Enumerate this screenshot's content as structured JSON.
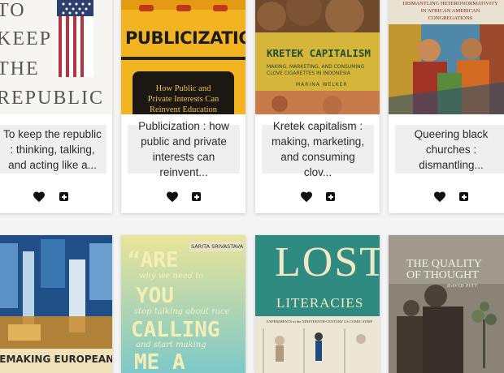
{
  "books_row1": [
    {
      "title": "To keep the republic : thinking, talking, and acting like a...",
      "cover_text": [
        "TO",
        "KEEP",
        "THE",
        "REPUBLIC"
      ]
    },
    {
      "title": "Publicization : how public and private interests can reinvent...",
      "cover_title": "PUBLICIZATION",
      "cover_subtitle": [
        "How Public and",
        "Private Interests Can",
        "Reinvent Education"
      ]
    },
    {
      "title": "Kretek capitalism : making, marketing, and consuming clov...",
      "cover_title": "KRETEK CAPITALISM",
      "cover_subtitle": [
        "MAKING, MARKETING, AND CONSUMING",
        "CLOVE CIGARETTES IN INDONESIA"
      ],
      "cover_author": "MARINA WELKER"
    },
    {
      "title": "Queering black churches : dismantling...",
      "cover_subtitle": [
        "DISMANTLING HETERONORMATIVITY",
        "IN AFRICAN AMERICAN",
        "CONGREGATIONS"
      ]
    }
  ],
  "books_row2": [
    {
      "cover_title": "REMAKING EUROPEAN"
    },
    {
      "cover_author": "SARITA SRIVASTAVA",
      "cover_lines": [
        "“ARE",
        "why we need to",
        "YOU",
        "stop talking about race",
        "CALLING",
        "and start making",
        "ME A"
      ]
    },
    {
      "cover_title": [
        "LOST",
        "LITERACIES"
      ],
      "cover_subtitle": "EXPERIMENTS in the NINETEENTH-CENTURY US COMIC STRIP"
    },
    {
      "cover_title": [
        "THE QUALITY",
        "OF THOUGHT"
      ],
      "cover_author": "DAVID PITT"
    }
  ],
  "icons": {
    "favorite": "heart-icon",
    "add": "add-square-icon"
  },
  "colors": {
    "background": "#f4f4f4",
    "card": "#ffffff",
    "title_box": "#efefef",
    "icon": "#111111"
  }
}
